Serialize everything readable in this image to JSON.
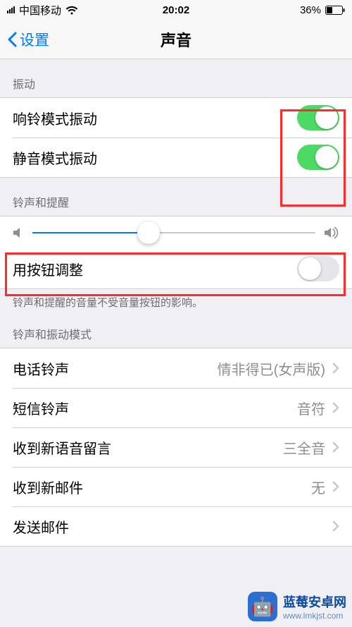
{
  "statusbar": {
    "carrier": "中国移动",
    "time": "20:02",
    "battery_pct": "36%"
  },
  "nav": {
    "back_label": "设置",
    "title": "声音"
  },
  "sections": {
    "vibration_header": "振动",
    "ringer_header": "铃声和提醒",
    "footer_text": "铃声和提醒的音量不受音量按钮的影响。",
    "patterns_header": "铃声和振动模式"
  },
  "rows": {
    "vibrate_on_ring": {
      "label": "响铃模式振动",
      "on": true
    },
    "vibrate_on_silent": {
      "label": "静音模式振动",
      "on": true
    },
    "ringer_volume_pct": 41,
    "change_with_buttons": {
      "label": "用按钮调整",
      "on": false
    },
    "ringtone": {
      "label": "电话铃声",
      "value": "情非得已(女声版)"
    },
    "text_tone": {
      "label": "短信铃声",
      "value": "音符"
    },
    "new_voicemail": {
      "label": "收到新语音留言",
      "value": "三全音"
    },
    "new_mail": {
      "label": "收到新邮件",
      "value": "无"
    },
    "sent_mail": {
      "label": "发送邮件",
      "value": ""
    }
  },
  "watermark": {
    "line1": "蓝莓安卓网",
    "line2": "www.lmkjst.com"
  }
}
